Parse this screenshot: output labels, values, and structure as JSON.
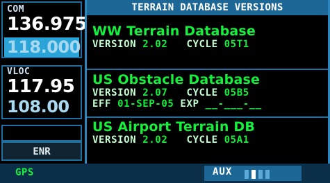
{
  "left": {
    "com": {
      "label": "COM",
      "active_freq": "136.975",
      "standby_freq": "118.000"
    },
    "vloc": {
      "label": "VLOC",
      "active_freq": "117.95",
      "standby_freq": "108.00"
    },
    "mode": "ENR"
  },
  "page": {
    "title": "TERRAIN DATABASE VERSIONS",
    "databases": [
      {
        "name": "WW Terrain Database",
        "version_label": "VERSION",
        "version": "2.02",
        "cycle_label": "CYCLE",
        "cycle": "05T1"
      },
      {
        "name": "US Obstacle Database",
        "version_label": "VERSION",
        "version": "2.07",
        "cycle_label": "CYCLE",
        "cycle": "05B5",
        "eff_label": "EFF",
        "eff": "01-SEP-05",
        "exp_label": "EXP",
        "exp": "__-___-__"
      },
      {
        "name": "US Airport Terrain DB",
        "version_label": "VERSION",
        "version": "2.02",
        "cycle_label": "CYCLE",
        "cycle": "05A1"
      }
    ]
  },
  "status": {
    "left": "GPS",
    "page_group": "AUX",
    "page_count": 4,
    "active_page": 2
  },
  "colors": {
    "green": "#14f03c",
    "cyan": "#2aa4d8",
    "title_bg": "#1d6796",
    "border": "#1f6fa0"
  }
}
